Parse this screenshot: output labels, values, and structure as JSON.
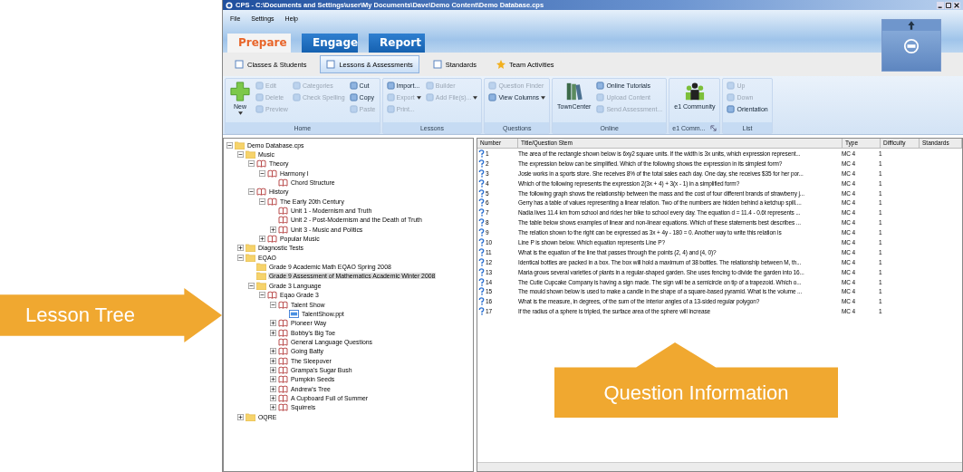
{
  "window": {
    "title": "CPS - C:\\Documents and Settings\\user\\My Documents\\Dave\\Demo Content\\Demo Database.cps"
  },
  "menu": [
    "File",
    "Settings",
    "Help"
  ],
  "tabs": [
    {
      "label": "Prepare",
      "selected": true
    },
    {
      "label": "Engage",
      "selected": false
    },
    {
      "label": "Report",
      "selected": false
    }
  ],
  "subtabs": [
    {
      "label": "Classes & Students",
      "selected": false
    },
    {
      "label": "Lessons & Assessments",
      "selected": true
    },
    {
      "label": "Standards",
      "selected": false
    },
    {
      "label": "Team Activities",
      "selected": false
    }
  ],
  "ribbon": [
    {
      "label": "Home",
      "launcher": false,
      "columns": [
        [
          {
            "label": "New",
            "kind": "large",
            "disabled": false,
            "dropdown": true
          }
        ],
        [
          {
            "label": "Edit",
            "kind": "small",
            "disabled": true,
            "dropdown": false
          },
          {
            "label": "Delete",
            "kind": "small",
            "disabled": true,
            "dropdown": false
          },
          {
            "label": "Preview",
            "kind": "small",
            "disabled": true,
            "dropdown": false
          }
        ],
        [
          {
            "label": "Categories",
            "kind": "small",
            "disabled": true,
            "dropdown": false
          },
          {
            "label": "Check Spelling",
            "kind": "small",
            "disabled": true,
            "dropdown": false
          }
        ],
        [
          {
            "label": "Cut",
            "kind": "small",
            "disabled": false,
            "dropdown": false
          },
          {
            "label": "Copy",
            "kind": "small",
            "disabled": false,
            "dropdown": false
          },
          {
            "label": "Paste",
            "kind": "small",
            "disabled": true,
            "dropdown": false
          }
        ]
      ]
    },
    {
      "label": "Lessons",
      "launcher": false,
      "columns": [
        [
          {
            "label": "Import...",
            "kind": "small",
            "disabled": false,
            "dropdown": false
          },
          {
            "label": "Export",
            "kind": "small",
            "disabled": true,
            "dropdown": true
          },
          {
            "label": "Print...",
            "kind": "small",
            "disabled": true,
            "dropdown": false
          }
        ],
        [
          {
            "label": "Builder",
            "kind": "small",
            "disabled": true,
            "dropdown": false
          },
          {
            "label": "Add File(s)...",
            "kind": "small",
            "disabled": true,
            "dropdown": true
          }
        ]
      ]
    },
    {
      "label": "Questions",
      "launcher": false,
      "columns": [
        [
          {
            "label": "Question Finder",
            "kind": "small",
            "disabled": true,
            "dropdown": false
          },
          {
            "label": "View Columns",
            "kind": "small",
            "disabled": false,
            "dropdown": true
          }
        ]
      ]
    },
    {
      "label": "Online",
      "launcher": false,
      "columns": [
        [
          {
            "label": "TownCenter",
            "kind": "large",
            "disabled": false,
            "dropdown": false
          }
        ],
        [
          {
            "label": "Online Tutorials",
            "kind": "small",
            "disabled": false,
            "dropdown": false
          },
          {
            "label": "Upload Content",
            "kind": "small",
            "disabled": true,
            "dropdown": false
          },
          {
            "label": "Send Assessment...",
            "kind": "small",
            "disabled": true,
            "dropdown": false
          }
        ]
      ]
    },
    {
      "label": "e1 Comm...",
      "launcher": true,
      "columns": [
        [
          {
            "label": "e1 Community",
            "kind": "large",
            "disabled": false,
            "dropdown": false
          }
        ]
      ]
    },
    {
      "label": "List",
      "launcher": false,
      "columns": [
        [
          {
            "label": "Up",
            "kind": "small",
            "disabled": true,
            "dropdown": false
          },
          {
            "label": "Down",
            "kind": "small",
            "disabled": true,
            "dropdown": false
          },
          {
            "label": "Orientation",
            "kind": "small",
            "disabled": false,
            "dropdown": false
          }
        ]
      ]
    }
  ],
  "tree": [
    {
      "label": "Demo Database.cps",
      "kind": "folder",
      "expanded": true,
      "selected": false,
      "children": [
        {
          "label": "Music",
          "kind": "folder",
          "expanded": true,
          "selected": false,
          "children": [
            {
              "label": "Theory",
              "kind": "book",
              "expanded": true,
              "selected": false,
              "children": [
                {
                  "label": "Harmony I",
                  "kind": "book",
                  "expanded": true,
                  "selected": false,
                  "children": [
                    {
                      "label": "Chord Structure",
                      "kind": "book",
                      "selected": false
                    }
                  ]
                }
              ]
            },
            {
              "label": "History",
              "kind": "book",
              "expanded": true,
              "selected": false,
              "children": [
                {
                  "label": "The Early 20th Century",
                  "kind": "book",
                  "expanded": true,
                  "selected": false,
                  "children": [
                    {
                      "label": "Unit 1 - Modernism and Truth",
                      "kind": "book",
                      "selected": false
                    },
                    {
                      "label": "Unit 2 - Post-Modernism and the Death of Truth",
                      "kind": "book",
                      "selected": false
                    },
                    {
                      "label": "Unit 3 - Music and Politics",
                      "kind": "book",
                      "expanded": false,
                      "selected": false
                    }
                  ]
                },
                {
                  "label": "Popular Music",
                  "kind": "book",
                  "expanded": false,
                  "selected": false
                }
              ]
            }
          ]
        },
        {
          "label": "Diagnostic Tests",
          "kind": "folder",
          "expanded": false,
          "selected": false
        },
        {
          "label": "EQAO",
          "kind": "folder",
          "expanded": true,
          "selected": false,
          "children": [
            {
              "label": "Grade 9 Academic Math EQAO Spring 2008",
              "kind": "folder",
              "selected": false
            },
            {
              "label": "Grade 9 Assessment of Mathematics Academic Winter 2008",
              "kind": "folder",
              "selected": true
            },
            {
              "label": "Grade 3 Language",
              "kind": "folder",
              "expanded": true,
              "selected": false,
              "children": [
                {
                  "label": "Eqao Grade 3",
                  "kind": "book",
                  "expanded": true,
                  "selected": false,
                  "children": [
                    {
                      "label": "Talent Show",
                      "kind": "book",
                      "expanded": true,
                      "selected": false,
                      "children": [
                        {
                          "label": "TalentShow.ppt",
                          "kind": "file",
                          "selected": false
                        }
                      ]
                    },
                    {
                      "label": "Pioneer Way",
                      "kind": "book",
                      "expanded": false,
                      "selected": false
                    },
                    {
                      "label": "Bobby's Big Toe",
                      "kind": "book",
                      "expanded": false,
                      "selected": false
                    },
                    {
                      "label": "General Language Questions",
                      "kind": "book",
                      "selected": false
                    },
                    {
                      "label": "Going Batty",
                      "kind": "book",
                      "expanded": false,
                      "selected": false
                    },
                    {
                      "label": "The Sleepover",
                      "kind": "book",
                      "expanded": false,
                      "selected": false
                    },
                    {
                      "label": "Grampa's Sugar Bush",
                      "kind": "book",
                      "expanded": false,
                      "selected": false
                    },
                    {
                      "label": "Pumpkin Seeds",
                      "kind": "book",
                      "expanded": false,
                      "selected": false
                    },
                    {
                      "label": "Andrew's Tree",
                      "kind": "book",
                      "expanded": false,
                      "selected": false
                    },
                    {
                      "label": "A Cupboard Full of Summer",
                      "kind": "book",
                      "expanded": false,
                      "selected": false
                    },
                    {
                      "label": "Squirrels",
                      "kind": "book",
                      "expanded": false,
                      "selected": false
                    }
                  ]
                }
              ]
            }
          ]
        },
        {
          "label": "OQRE",
          "kind": "folder",
          "expanded": false,
          "selected": false
        }
      ]
    }
  ],
  "table": {
    "columns": [
      "Number",
      "Title/Question Stem",
      "Type",
      "Difficulty",
      "Standards"
    ],
    "rows": [
      {
        "number": "1",
        "title": "The area of the rectangle shown below is 6xy2 square units. If the width is 3x units, which expression represent...",
        "type": "MC 4",
        "difficulty": "1"
      },
      {
        "number": "2",
        "title": "The expression below can be simplified. Which of the following shows the expression in its simplest form?",
        "type": "MC 4",
        "difficulty": "1"
      },
      {
        "number": "3",
        "title": "Josie works in a sports store. She receives 8% of the total sales each day. One day, she receives $35 for her por...",
        "type": "MC 4",
        "difficulty": "1"
      },
      {
        "number": "4",
        "title": "Which of the following represents the expression 2(3x + 4) + 3(x - 1) in a simplified form?",
        "type": "MC 4",
        "difficulty": "1"
      },
      {
        "number": "5",
        "title": "The following graph shows the relationship between the mass and the cost of four different brands of strawberry j...",
        "type": "MC 4",
        "difficulty": "1"
      },
      {
        "number": "6",
        "title": "Gerry has a table of values representing a linear relation. Two of the numbers are hidden behind a ketchup spill....",
        "type": "MC 4",
        "difficulty": "1"
      },
      {
        "number": "7",
        "title": "Nadia lives 11.4 km from school and rides her bike to school every day. The equation d = 11.4 - 0.6t represents ...",
        "type": "MC 4",
        "difficulty": "1"
      },
      {
        "number": "8",
        "title": "The table below shows examples of linear and non-linear equations. Which of these statements best describes ...",
        "type": "MC 4",
        "difficulty": "1"
      },
      {
        "number": "9",
        "title": "The relation shown to the right can be expressed as 3x + 4y - 180 = 0. Another way to write this relation is",
        "type": "MC 4",
        "difficulty": "1"
      },
      {
        "number": "10",
        "title": "Line P is shown below. Which equation represents Line P?",
        "type": "MC 4",
        "difficulty": "1"
      },
      {
        "number": "11",
        "title": "What is the equation of the line that passes through the points (2, 4) and (4, 0)?",
        "type": "MC 4",
        "difficulty": "1"
      },
      {
        "number": "12",
        "title": "Identical bottles are packed in a box. The box will hold a maximum of 38 bottles. The relationship between M, th...",
        "type": "MC 4",
        "difficulty": "1"
      },
      {
        "number": "13",
        "title": "Maria grows several varieties of plants in a regular-shaped garden. She uses fencing to divide the garden into 16...",
        "type": "MC 4",
        "difficulty": "1"
      },
      {
        "number": "14",
        "title": "The Cutie Cupcake Company is having a sign made. The sign will be a semicircle on tip of a trapezoid. Which o...",
        "type": "MC 4",
        "difficulty": "1"
      },
      {
        "number": "15",
        "title": "The mould shown below is used to make a candle in the shape of a square-based pyramid. What is the volume ...",
        "type": "MC 4",
        "difficulty": "1"
      },
      {
        "number": "16",
        "title": "What is the measure, in degrees, of the sum of the interior angles of a 13-sided regular polygon?",
        "type": "MC 4",
        "difficulty": "1"
      },
      {
        "number": "17",
        "title": "If the radius of a sphere is tripled, the surface area of the sphere will increase",
        "type": "MC 4",
        "difficulty": "1"
      }
    ]
  },
  "callouts": [
    {
      "label": "Lesson Tree",
      "kind": "right"
    },
    {
      "label": "Question Information",
      "kind": "up"
    }
  ]
}
